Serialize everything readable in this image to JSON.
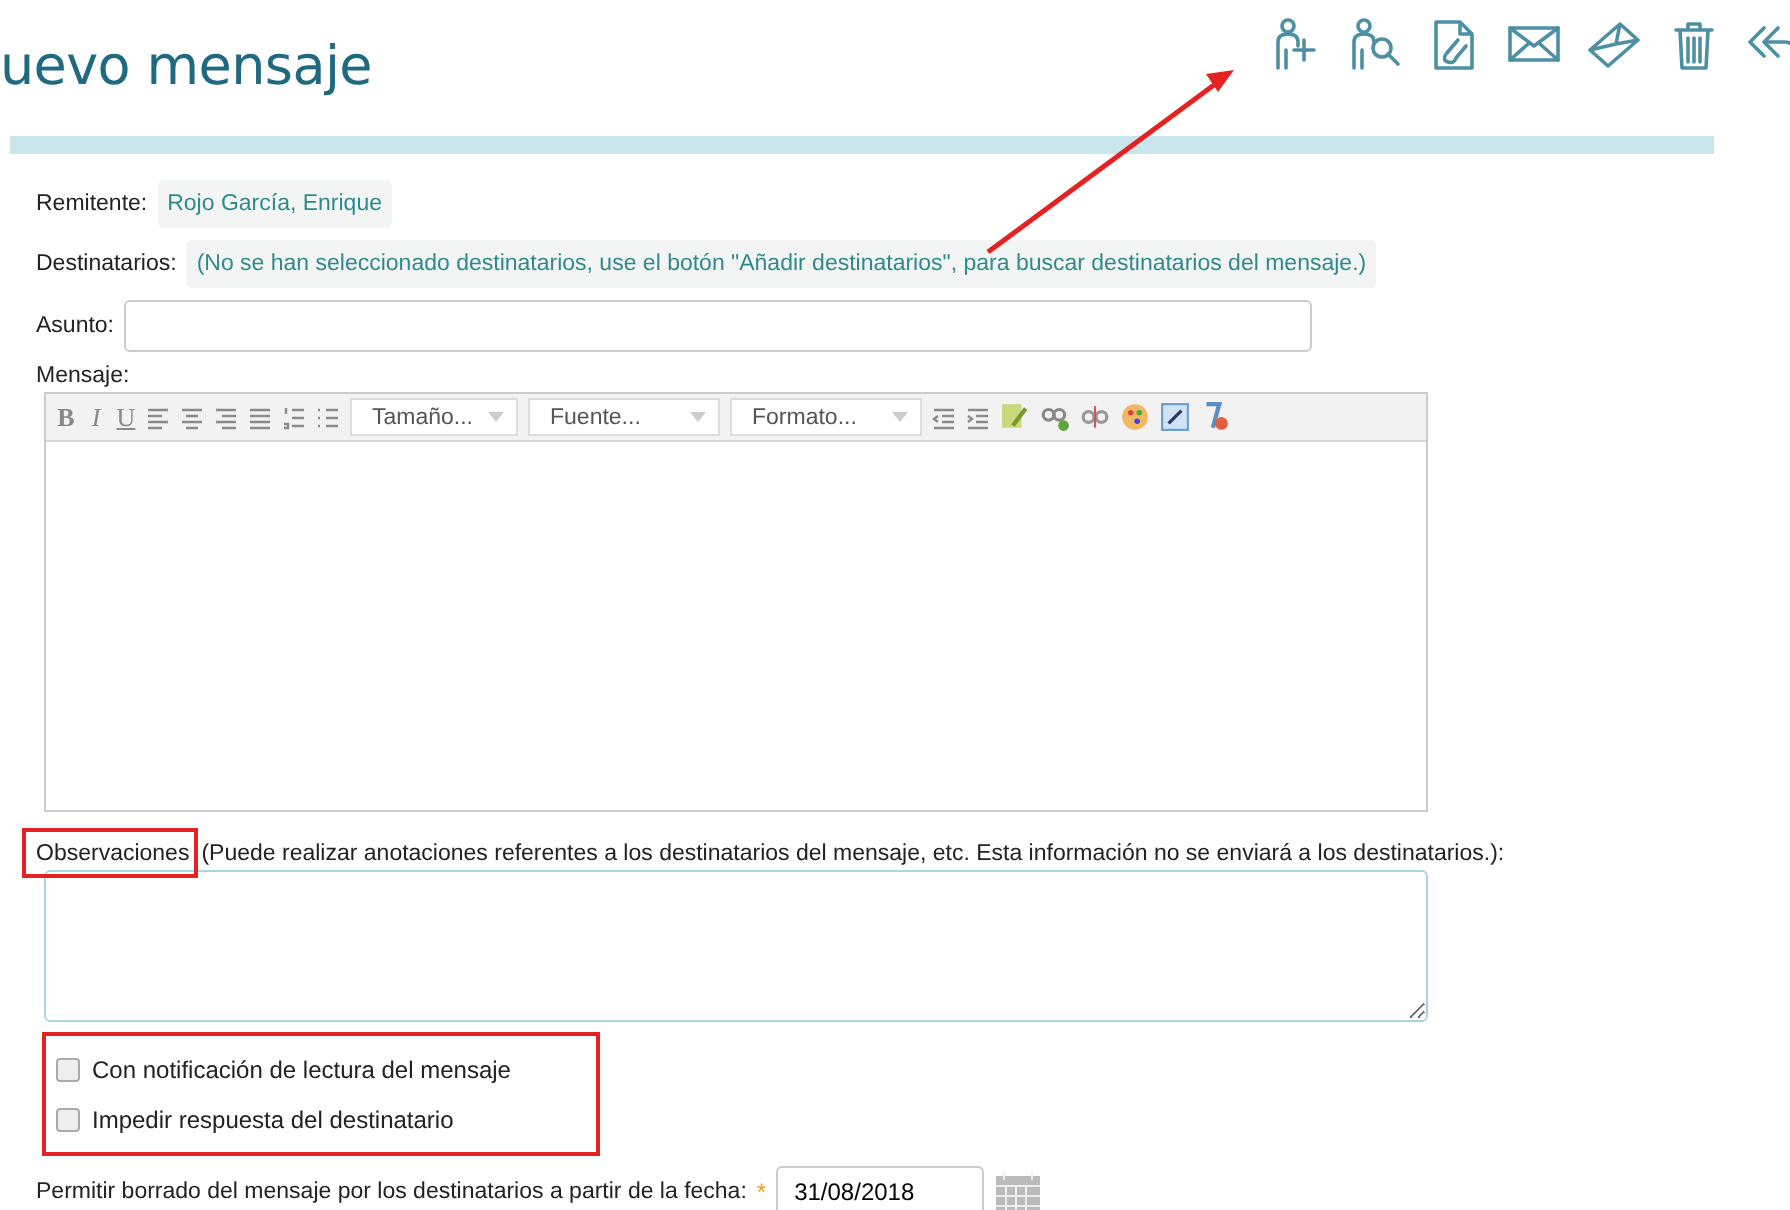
{
  "title": "uevo mensaje",
  "sender": {
    "label": "Remitente:",
    "value": "Rojo García, Enrique"
  },
  "recipients": {
    "label": "Destinatarios:",
    "value": "(No se han seleccionado destinatarios, use el botón \"Añadir destinatarios\", para buscar destinatarios del mensaje.)"
  },
  "subject": {
    "label": "Asunto:"
  },
  "message": {
    "label": "Mensaje:",
    "format_buttons": [
      "B",
      "I",
      "U"
    ],
    "selects": [
      "Tamaño...",
      "Fuente...",
      "Formato..."
    ]
  },
  "notes": {
    "label": "Observaciones",
    "hint": "(Puede realizar anotaciones referentes a los destinatarios del mensaje, etc. Esta información no se enviará a los destinatarios.):"
  },
  "options": [
    {
      "label": "Con notificación de lectura del mensaje",
      "checked": false
    },
    {
      "label": "Impedir respuesta del destinatario",
      "checked": false
    }
  ],
  "delete_date": {
    "label": "Permitir borrado del mensaje por los destinatarios a partir de la fecha:",
    "required_mark": "*",
    "value": "31/08/2018"
  }
}
